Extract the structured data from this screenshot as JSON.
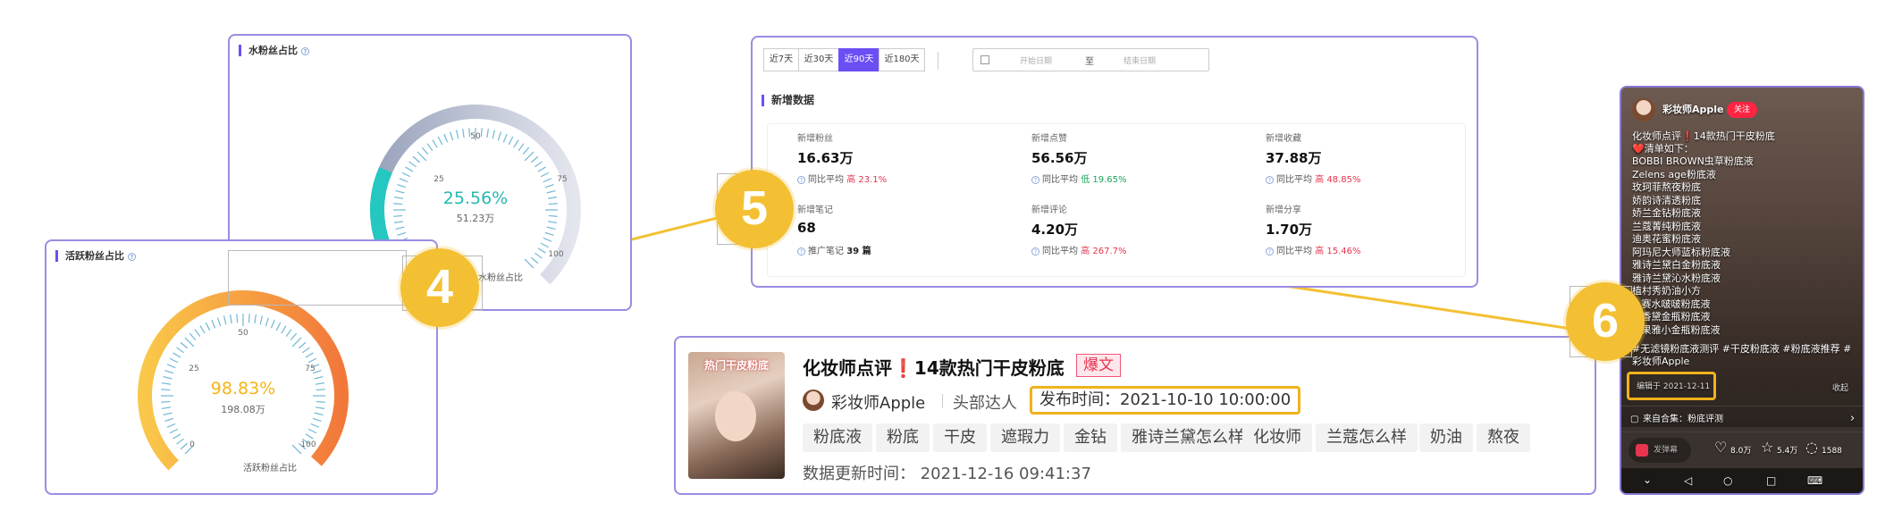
{
  "fan_ratio": {
    "title": "水粉丝占比",
    "percent": "25.56%",
    "sub": "51.23万",
    "label": "水粉丝占比",
    "ticks": [
      "25",
      "50",
      "75",
      "100"
    ],
    "level": 0.2556
  },
  "active_ratio": {
    "title": "活跃粉丝占比",
    "percent": "98.83%",
    "sub": "198.08万",
    "label": "活跃粉丝占比",
    "ticks": [
      "0",
      "25",
      "50",
      "75",
      "100"
    ],
    "level": 0.9883
  },
  "badges": {
    "b4": "4",
    "b5": "5",
    "b6": "6"
  },
  "date_filter": {
    "ranges": [
      "近7天",
      "近30天",
      "近90天",
      "近180天"
    ],
    "active_index": 2,
    "start_placeholder": "开始日期",
    "sep": "至",
    "end_placeholder": "结束日期"
  },
  "new_data": {
    "title": "新增数据",
    "stats": [
      {
        "label": "新增粉丝",
        "value": "16.63万",
        "cmp_label": "同比平均",
        "dir": "高",
        "cmp": "23.1%",
        "up": true
      },
      {
        "label": "新增点赞",
        "value": "56.56万",
        "cmp_label": "同比平均",
        "dir": "低",
        "cmp": "19.65%",
        "up": false
      },
      {
        "label": "新增收藏",
        "value": "37.88万",
        "cmp_label": "同比平均",
        "dir": "高",
        "cmp": "48.85%",
        "up": true
      },
      {
        "label": "新增笔记",
        "value": "68",
        "cmp_label": "推广笔记",
        "dir": "",
        "cmp": "39 篇",
        "up": null
      },
      {
        "label": "新增评论",
        "value": "4.20万",
        "cmp_label": "同比平均",
        "dir": "高",
        "cmp": "267.7%",
        "up": true
      },
      {
        "label": "新增分享",
        "value": "1.70万",
        "cmp_label": "同比平均",
        "dir": "高",
        "cmp": "15.46%",
        "up": true
      }
    ]
  },
  "note_card": {
    "title": "化妆师点评❗14款热门干皮粉底",
    "hot_tag": "爆文",
    "author": "彩妆师Apple",
    "author_level": "头部达人",
    "publish_time": "发布时间：2021-10-10 10:00:00",
    "tags": [
      "粉底液",
      "粉底",
      "干皮",
      "遮瑕力",
      "金钻",
      "雅诗兰黛怎么样",
      "化妆师",
      "兰蔻怎么样",
      "奶油",
      "熬夜"
    ],
    "update_time": "数据更新时间：  2021-12-16 09:41:37",
    "thumb_text": "热门干皮粉底"
  },
  "phone": {
    "author": "彩妆师Apple",
    "follow": "关注",
    "title": "化妆师点评❗14款热门干皮粉底",
    "list_head": "❤️清单如下：",
    "items": [
      "BOBBI BROWN虫草粉底液",
      "Zelens age粉底液",
      "玫珂菲熬夜粉底",
      "娇韵诗清透粉底",
      "娇兰金钻粉底液",
      "兰蔻菁纯粉底液",
      "迪奥花蜜粉底液",
      "阿玛尼大师蓝标粉底液",
      "雅诗兰黛白金粉底液",
      "雅诗兰黛沁水粉底液",
      "植村秀奶油小方",
      "...赛水啵啵粉底液",
      "...香黛金瓶粉底液",
      "...果雅小金瓶粉底液"
    ],
    "hashtags": "#无滤镜粉底液测评 #干皮粉底液 #粉底液推荐 #彩妆师Apple",
    "edit_time": "编辑于 2021-12-11",
    "collapse": "收起",
    "collection": "来自合集：粉底评测",
    "danmaku": "发弹幕",
    "likes": "8.0万",
    "stars": "5.4万",
    "comments": "1588"
  }
}
